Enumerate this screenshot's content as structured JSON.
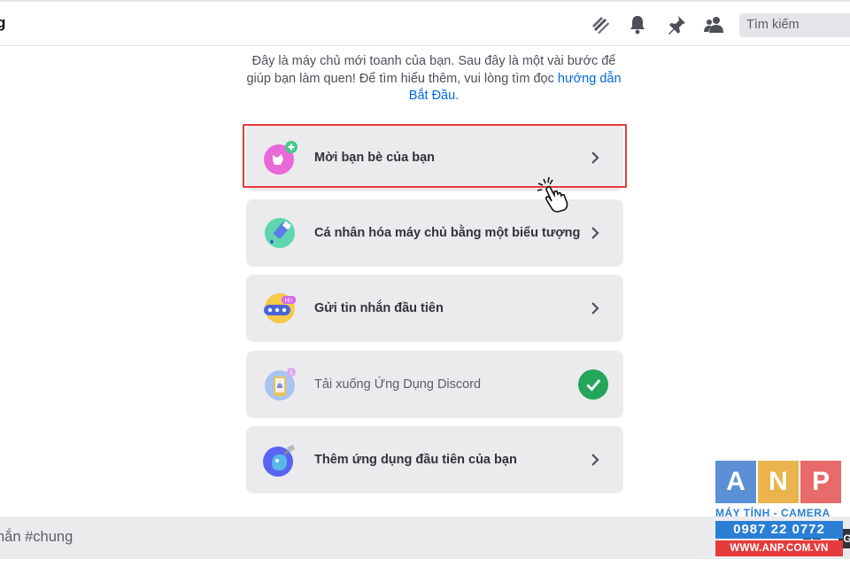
{
  "header": {
    "channel_name_fragment": "g",
    "icons": [
      "threads-icon",
      "bell-icon",
      "pin-icon",
      "members-icon"
    ],
    "search_placeholder": "Tìm kiếm"
  },
  "intro": {
    "text": "Đây là máy chủ mới toanh của bạn. Sau đây là một vài bước để giúp bạn làm quen! Để tìm hiểu thêm, vui lòng tìm đọc ",
    "link": "hướng dẫn Bắt Đầu",
    "end": "."
  },
  "checklist": [
    {
      "label": "Mời bạn bè của bạn",
      "icon": "invite-friends-icon",
      "done": false
    },
    {
      "label": "Cá nhân hóa máy chủ bằng một biểu tượng",
      "icon": "personalize-icon",
      "done": false
    },
    {
      "label": "Gửi tin nhắn đầu tiên",
      "icon": "message-icon",
      "done": false
    },
    {
      "label": "Tải xuống Ứng Dụng Discord",
      "icon": "download-app-icon",
      "done": true
    },
    {
      "label": "Thêm ứng dụng đầu tiên của bạn",
      "icon": "add-app-icon",
      "done": false
    }
  ],
  "composer": {
    "placeholder_fragment": "nắn #chung",
    "gif_fragment": "G"
  },
  "watermark": {
    "letters": [
      "A",
      "N",
      "P"
    ],
    "tagline": "MÁY TÍNH - CAMERA",
    "phone": "0987 22 0772",
    "site": "WWW.ANP.COM.VN",
    "colors": [
      "#5b8fd6",
      "#e9b44c",
      "#e86a6a"
    ]
  },
  "colors": {
    "highlight": "#e53b3b",
    "check": "#23a55a",
    "link": "#0068e0"
  }
}
